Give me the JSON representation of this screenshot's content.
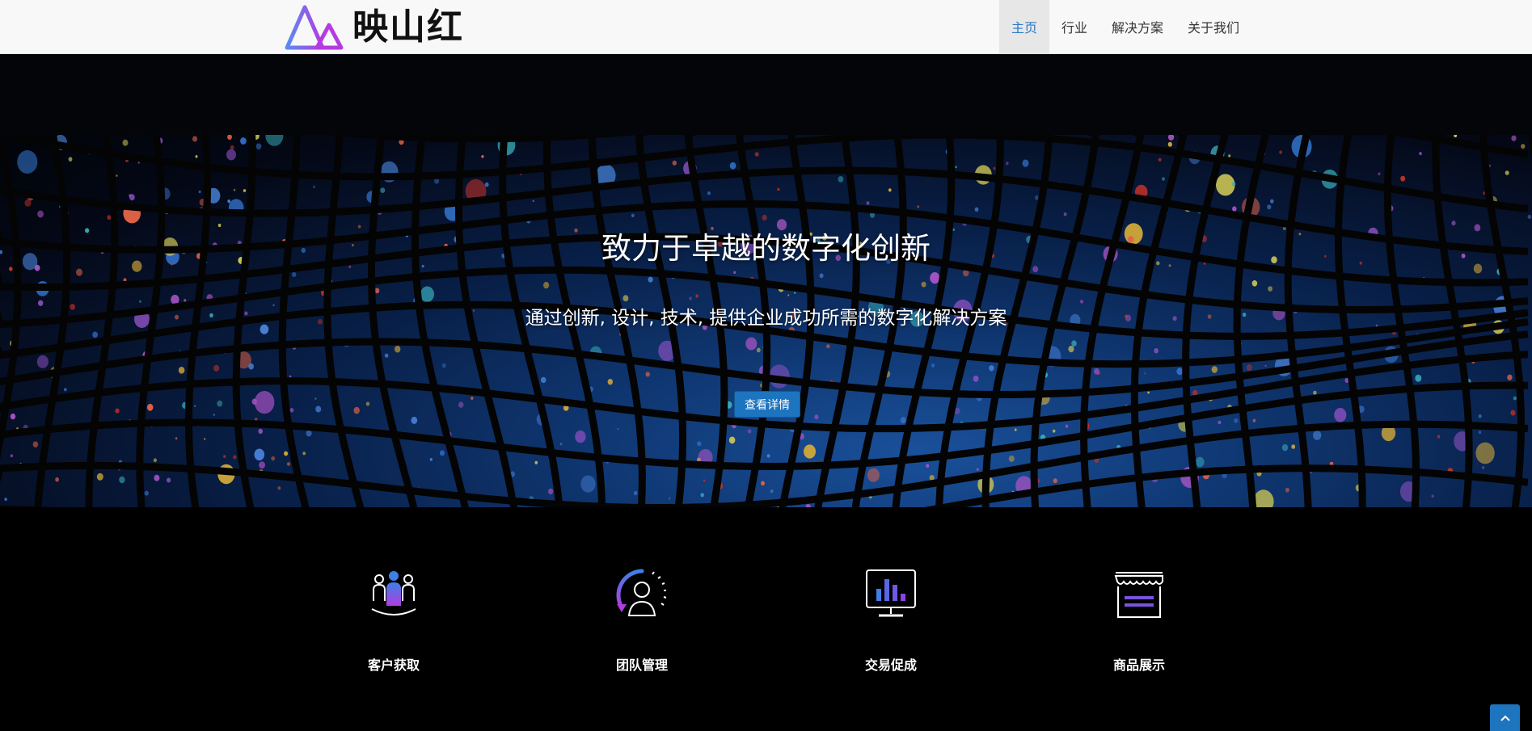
{
  "brand": {
    "name": "映山红"
  },
  "nav": {
    "items": [
      {
        "label": "主页",
        "active": true
      },
      {
        "label": "行业",
        "active": false
      },
      {
        "label": "解决方案",
        "active": false
      },
      {
        "label": "关于我们",
        "active": false
      }
    ]
  },
  "hero": {
    "title": "致力于卓越的数字化创新",
    "subtitle": "通过创新, 设计, 技术, 提供企业成功所需的数字化解决方案",
    "button_label": "查看详情"
  },
  "features": [
    {
      "label": "客户获取",
      "icon": "customer-acquisition-icon"
    },
    {
      "label": "团队管理",
      "icon": "team-management-icon"
    },
    {
      "label": "交易促成",
      "icon": "deal-closing-icon"
    },
    {
      "label": "商品展示",
      "icon": "product-display-icon"
    }
  ],
  "colors": {
    "accent": "#1d74bf",
    "nav_active_text": "#2a78c3",
    "icon_purple": "#7b52e0",
    "icon_blue": "#3f7fe6"
  }
}
